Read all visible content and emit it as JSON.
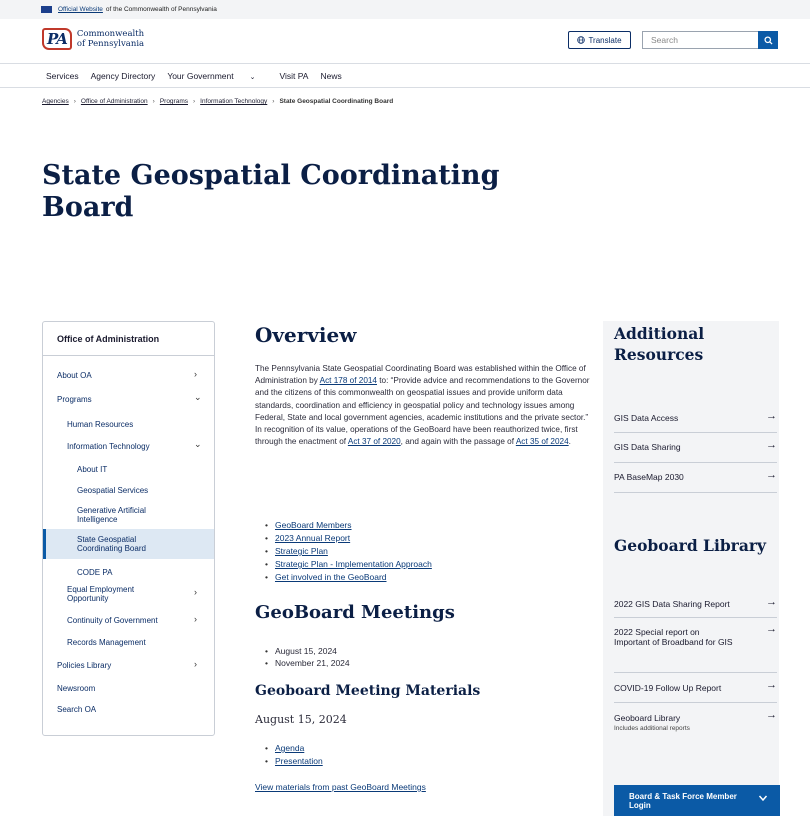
{
  "banner": {
    "link": "Official Website",
    "text": "of the Commonwealth of Pennsylvania"
  },
  "header": {
    "logo_mark": "PA",
    "logo_line1": "Commonwealth",
    "logo_line2": "of Pennsylvania",
    "translate": "Translate",
    "search_placeholder": "Search"
  },
  "nav": {
    "items": [
      "Services",
      "Agency Directory",
      "Your Government",
      "Visit PA",
      "News"
    ]
  },
  "breadcrumb": {
    "items": [
      "Agencies",
      "Office of Administration",
      "Programs",
      "Information Technology"
    ],
    "current": "State Geospatial Coordinating Board"
  },
  "page_title": "State Geospatial Coordinating Board",
  "sidebar": {
    "heading": "Office of Administration",
    "items": [
      {
        "label": "About OA"
      },
      {
        "label": "Programs"
      },
      {
        "label": "Human Resources"
      },
      {
        "label": "Information Technology"
      },
      {
        "label": "About IT"
      },
      {
        "label": "Geospatial Services"
      },
      {
        "label": "Generative Artificial Intelligence"
      },
      {
        "label": "State Geospatial Coordinating Board"
      },
      {
        "label": "CODE PA"
      },
      {
        "label": "Equal Employment Opportunity"
      },
      {
        "label": "Continuity of Government"
      },
      {
        "label": "Records Management"
      },
      {
        "label": "Policies Library"
      },
      {
        "label": "Newsroom"
      },
      {
        "label": "Search OA"
      }
    ]
  },
  "overview": {
    "title": "Overview",
    "p1": "The Pennsylvania State Geospatial Coordinating Board was established within the Office of Administration by ",
    "act1": "Act 178 of 2014",
    "p2": " to: “Provide advice and recommendations to the Governor and the citizens of this commonwealth on geospatial issues and provide uniform data standards, coordination and efficiency in geospatial policy and technology issues among Federal, State and local government agencies, academic institutions and the private sector.”  In recognition of its value, operations of the GeoBoard have been reauthorized twice, first through the enactment of ",
    "act2": "Act 37 of 2020",
    "p3": ", and again with the passage of ",
    "act3": "Act 35 of 2024",
    "p4": ".",
    "links": [
      "GeoBoard Members",
      "2023 Annual Report",
      "Strategic Plan",
      "Strategic Plan - Implementation Approach",
      "Get involved in the GeoBoard"
    ]
  },
  "meetings": {
    "title": "GeoBoard Meetings",
    "dates": [
      "August 15, 2024",
      "November 21, 2024"
    ]
  },
  "materials": {
    "title": "Geoboard Meeting Materials",
    "date": "August 15, 2024",
    "links": [
      "Agenda",
      "Presentation"
    ],
    "past_link": "View materials from past GeoBoard Meetings"
  },
  "resources": {
    "title": "Additional Resources",
    "items": [
      "GIS Data Access",
      "GIS Data Sharing",
      "PA BaseMap 2030"
    ]
  },
  "library": {
    "title": "Geoboard Library",
    "items": [
      {
        "label": "2022 GIS Data Sharing Report"
      },
      {
        "label": "2022 Special report on Important of Broadband for GIS"
      },
      {
        "label": "COVID-19 Follow Up Report"
      },
      {
        "label": "Geoboard Library",
        "sub": "Includes additional reports"
      }
    ]
  },
  "login": {
    "label": "Board & Task Force Member Login"
  }
}
